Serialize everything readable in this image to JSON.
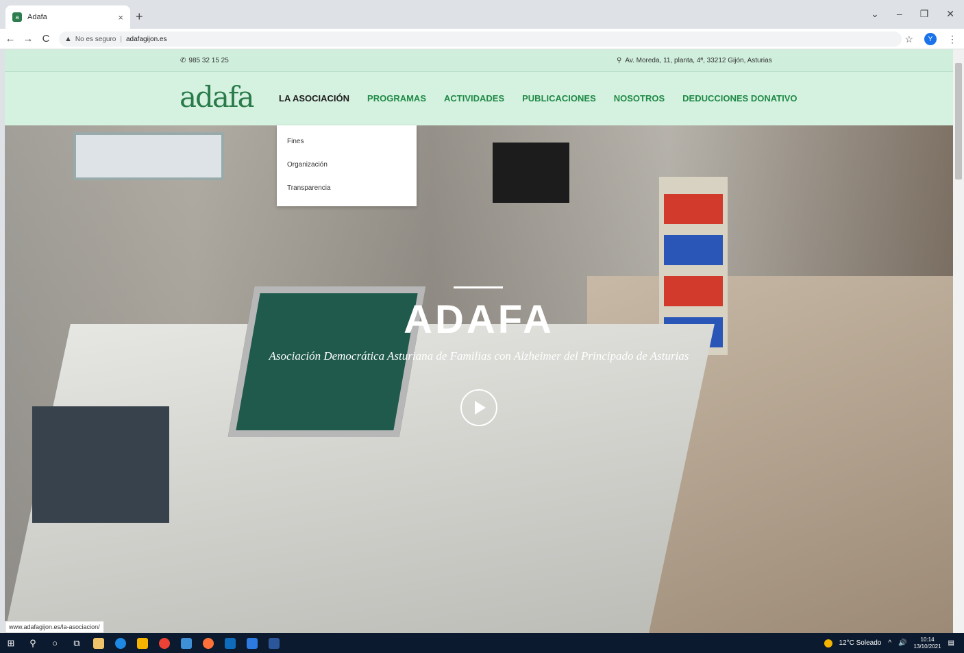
{
  "browser": {
    "tab_title": "Adafa",
    "tab_close": "×",
    "new_tab": "+",
    "nav_back": "←",
    "nav_forward": "→",
    "nav_reload": "C",
    "security_label": "No es seguro",
    "url": "adafagijon.es",
    "window_controls": [
      "⌄",
      "–",
      "❐",
      "✕"
    ],
    "profile_initial": "Y"
  },
  "site": {
    "phone": "985 32 15 25",
    "address": "Av. Moreda, 11, planta, 4ª, 33212 Gijón, Asturias",
    "logo_text": "adafa",
    "nav": [
      {
        "label": "LA ASOCIACIÓN",
        "active": true
      },
      {
        "label": "PROGRAMAS",
        "active": false
      },
      {
        "label": "ACTIVIDADES",
        "active": false
      },
      {
        "label": "PUBLICACIONES",
        "active": false
      },
      {
        "label": "NOSOTROS",
        "active": false
      },
      {
        "label": "DEDUCCIONES DONATIVO",
        "active": false
      }
    ],
    "dropdown": [
      "Fines",
      "Organización",
      "Transparencia"
    ],
    "hero": {
      "title": "ADAFA",
      "subtitle": "Asociación Democrática Asturiana de Familias con Alzheimer del Principado de Asturias"
    },
    "status_url": "www.adafagijon.es/la-asociacion/"
  },
  "taskbar": {
    "weather": "12°C Soleado",
    "time": "10:14",
    "date": "13/10/2021"
  },
  "colors": {
    "topbar_bg": "#cfeedc",
    "header_bg": "#d5f1e0",
    "nav_green": "#1f8a46",
    "taskbar_bg": "#0b1a2e"
  }
}
